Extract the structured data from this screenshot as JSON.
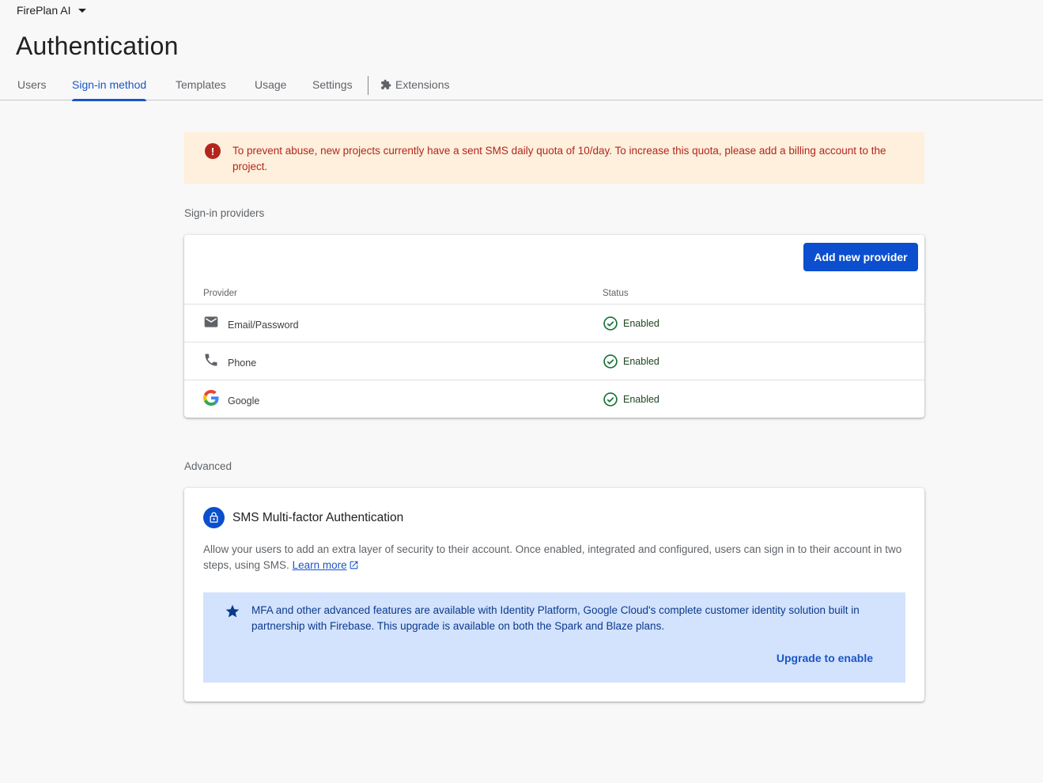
{
  "header": {
    "project_name": "FirePlan AI",
    "page_title": "Authentication"
  },
  "tabs": [
    {
      "label": "Users",
      "active": false
    },
    {
      "label": "Sign-in method",
      "active": true
    },
    {
      "label": "Templates",
      "active": false
    },
    {
      "label": "Usage",
      "active": false
    },
    {
      "label": "Settings",
      "active": false
    },
    {
      "label": "Extensions",
      "active": false,
      "icon": "puzzle-icon"
    }
  ],
  "alert": {
    "icon": "error-icon",
    "text": "To prevent abuse, new projects currently have a sent SMS daily quota of 10/day. To increase this quota, please add a billing account to the project."
  },
  "providers_section": {
    "label": "Sign-in providers",
    "add_button_label": "Add new provider",
    "columns": {
      "provider": "Provider",
      "status": "Status"
    },
    "rows": [
      {
        "name": "Email/Password",
        "icon": "mail-icon",
        "status": "Enabled"
      },
      {
        "name": "Phone",
        "icon": "phone-icon",
        "status": "Enabled"
      },
      {
        "name": "Google",
        "icon": "google-icon",
        "status": "Enabled"
      }
    ]
  },
  "advanced_section": {
    "label": "Advanced",
    "mfa": {
      "title": "SMS Multi-factor Authentication",
      "icon": "lock-icon",
      "description": "Allow your users to add an extra layer of security to their account. Once enabled, integrated and configured, users can sign in to their account in two steps, using SMS.",
      "learn_more_label": "Learn more",
      "upgrade_text": "MFA and other advanced features are available with Identity Platform, Google Cloud's complete customer identity solution built in partnership with Firebase. This upgrade is available on both the Spark and Blaze plans.",
      "upgrade_link_label": "Upgrade to enable"
    }
  },
  "colors": {
    "accent": "#0b4fcf",
    "alert_bg": "#fef0dc",
    "alert_text": "#b3261e",
    "upgrade_bg": "#d3e3fd",
    "enabled_green": "#137333"
  }
}
